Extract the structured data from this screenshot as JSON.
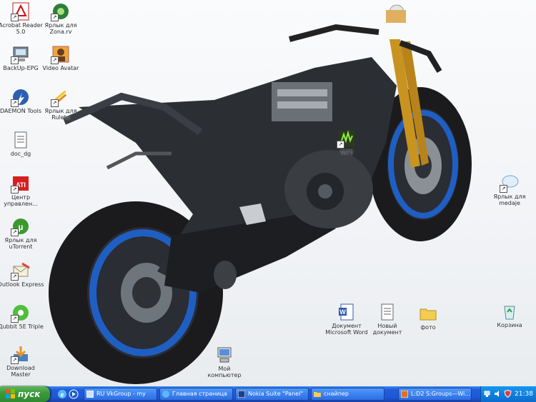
{
  "desktop_icons": [
    {
      "id": "acrobat",
      "label": "Acrobat Reader 5.0",
      "icon": "pdf-icon"
    },
    {
      "id": "yarlyk-zona",
      "label": "Ярлык для Zona.rv",
      "icon": "zona-icon"
    },
    {
      "id": "backup",
      "label": "BackUp-EPG",
      "icon": "computer-icon"
    },
    {
      "id": "video-avatar",
      "label": "Video Avatar",
      "icon": "avatar-icon"
    },
    {
      "id": "daemon",
      "label": "DAEMON Tools",
      "icon": "daemon-icon"
    },
    {
      "id": "yarlyk-pens",
      "label": "Ярлык для Ruleto",
      "icon": "pens-icon"
    },
    {
      "id": "doc",
      "label": "doc_dg",
      "icon": "text-file-icon"
    },
    {
      "id": "ati",
      "label": "Центр управлен...",
      "icon": "ati-icon"
    },
    {
      "id": "utorrent",
      "label": "Ярлык для uTorrent",
      "icon": "utorrent-icon"
    },
    {
      "id": "outlook",
      "label": "Outlook Express",
      "icon": "mail-icon"
    },
    {
      "id": "dvd",
      "label": "Дubbit 5E Triple",
      "icon": "dvd-icon"
    },
    {
      "id": "download-master",
      "label": "Download Master",
      "icon": "download-icon"
    },
    {
      "id": "my-computer",
      "label": "Мой компьютер",
      "icon": "my-computer-icon"
    },
    {
      "id": "word-doc",
      "label": "Документ Microsoft Word",
      "icon": "word-icon"
    },
    {
      "id": "text-doc",
      "label": "Новый документ",
      "icon": "text-file-icon"
    },
    {
      "id": "folder",
      "label": "фото",
      "icon": "folder-icon"
    },
    {
      "id": "recycle",
      "label": "Корзина",
      "icon": "recycle-bin-icon"
    },
    {
      "id": "yarlyk-bubble",
      "label": "Ярлык для medaje",
      "icon": "speech-bubble-icon"
    },
    {
      "id": "green-app",
      "label": "TATE",
      "icon": "green-app-icon"
    }
  ],
  "taskbar": {
    "start_label": "пуск",
    "quick_launch": [
      "internet-explorer-icon",
      "media-player-icon"
    ],
    "tasks": [
      {
        "label": "RU VkGroup - my",
        "icon": "window-icon"
      },
      {
        "label": "Главная страница",
        "icon": "ie-icon"
      },
      {
        "label": "Nokia Suite \"Panel\"",
        "icon": "app-icon"
      },
      {
        "label": "снайпер",
        "icon": "folder-icon"
      },
      {
        "label": "L:D2 S:Groups—Wi...",
        "icon": "app-icon"
      }
    ],
    "tray_icons": [
      "network-icon",
      "speaker-icon",
      "shield-icon"
    ],
    "clock": "21:38"
  },
  "colors": {
    "taskbar": "#245edb",
    "start": "#3c9a3c",
    "tray": "#0f7fe0",
    "rim": "#1f5fc4"
  }
}
